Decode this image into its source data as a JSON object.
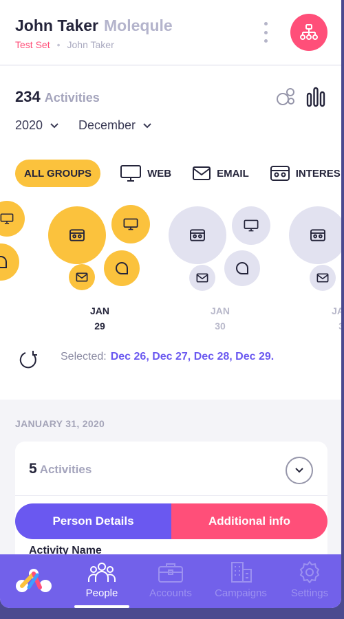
{
  "header": {
    "name": "John Taker",
    "org": "Molequle",
    "set_label": "Test Set",
    "owner": "John Taker",
    "more_icon": "kebab-menu-icon",
    "org_chart_icon": "org-chart-icon",
    "accent": "#ff4f79"
  },
  "summary": {
    "count": "234",
    "count_label": "Activities",
    "year": "2020",
    "month": "December",
    "views": [
      "bubbles-view-icon",
      "bars-view-icon"
    ]
  },
  "filters": [
    {
      "label": "ALL GROUPS",
      "active": true
    },
    {
      "label": "WEB",
      "icon": "monitor-icon"
    },
    {
      "label": "EMAIL",
      "icon": "envelope-icon"
    },
    {
      "label": "INTERES",
      "icon": "interest-icon"
    }
  ],
  "timeline": {
    "days": [
      {
        "month": "JAN",
        "day": "29",
        "selected": true
      },
      {
        "month": "JAN",
        "day": "30",
        "selected": false
      },
      {
        "month": "JA",
        "day": "3",
        "selected": false
      }
    ]
  },
  "selection": {
    "label": "Selected:",
    "dates": "Dec 26, Dec 27, Dec 28, Dec 29."
  },
  "day_section": {
    "date": "JANUARY 31, 2020",
    "count": "5",
    "count_label": "Activities",
    "tab_left": "Person Details",
    "tab_right": "Additional info",
    "column_header": "Activity Name"
  },
  "nav": {
    "items": [
      {
        "label": "People",
        "icon": "people-icon",
        "active": true
      },
      {
        "label": "Accounts",
        "icon": "briefcase-icon",
        "active": false
      },
      {
        "label": "Campaigns",
        "icon": "buildings-icon",
        "active": false
      },
      {
        "label": "Settings",
        "icon": "gear-icon",
        "active": false
      }
    ]
  },
  "colors": {
    "primary": "#6a58f0",
    "pink": "#ff4f79",
    "yellow": "#fbc23d",
    "nav": "#7261ea"
  }
}
